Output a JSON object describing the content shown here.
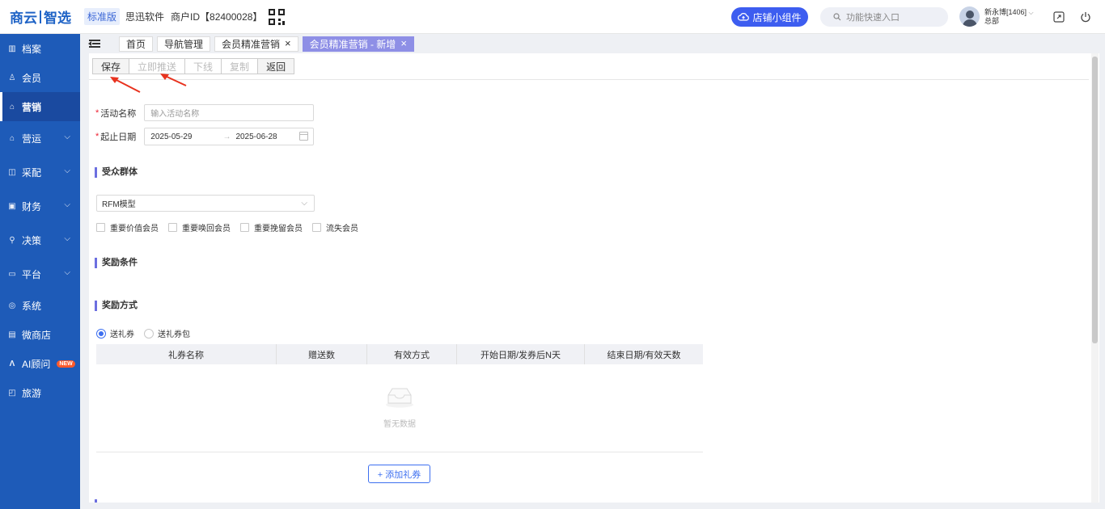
{
  "header": {
    "logo_part1": "商云",
    "logo_part2": "智选",
    "edition": "标准版",
    "company": "思迅软件",
    "merchant_id": "商户ID【82400028】",
    "widget_button": "店铺小组件",
    "search_placeholder": "功能快速入口",
    "user_name": "新永博[1406]",
    "user_org": "总部",
    "qr_icon": "qr-code-icon"
  },
  "sidebar": {
    "items": [
      {
        "label": "档案",
        "icon": "archive-icon"
      },
      {
        "label": "会员",
        "icon": "user-icon"
      },
      {
        "label": "营销",
        "icon": "marketing-icon"
      },
      {
        "label": "营运",
        "icon": "operation-icon"
      },
      {
        "label": "采配",
        "icon": "purchase-icon"
      },
      {
        "label": "财务",
        "icon": "finance-icon"
      },
      {
        "label": "决策",
        "icon": "decision-icon"
      },
      {
        "label": "平台",
        "icon": "platform-icon"
      },
      {
        "label": "系统",
        "icon": "system-icon"
      },
      {
        "label": "微商店",
        "icon": "store-icon"
      },
      {
        "label": "AI顾问",
        "icon": "ai-icon",
        "badge": "NEW"
      },
      {
        "label": "旅游",
        "icon": "travel-icon"
      }
    ]
  },
  "tabs": [
    {
      "label": "首页"
    },
    {
      "label": "导航管理"
    },
    {
      "label": "会员精准营销"
    },
    {
      "label": "会员精准营销 - 新增"
    }
  ],
  "toolbar": {
    "save": "保存",
    "push": "立即推送",
    "offline": "下线",
    "copy": "复制",
    "back": "返回"
  },
  "form": {
    "activity_name_label": "活动名称",
    "activity_name_placeholder": "输入活动名称",
    "date_label": "起止日期",
    "start_date": "2025-05-29",
    "date_sep": "→",
    "end_date": "2025-06-28"
  },
  "audience": {
    "title": "受众群体",
    "select_value": "RFM模型",
    "options": [
      "重要价值会员",
      "重要唤回会员",
      "重要挽留会员",
      "流失会员"
    ]
  },
  "reward_condition": {
    "title": "奖励条件"
  },
  "reward_method": {
    "title": "奖励方式",
    "radio_coupon": "送礼券",
    "radio_package": "送礼券包",
    "selected": "送礼券",
    "columns": [
      "礼券名称",
      "赠送数",
      "有效方式",
      "开始日期/发券后N天",
      "结束日期/有效天数"
    ],
    "empty_text": "暂无数据",
    "add_button": "+ 添加礼券"
  },
  "colors": {
    "sidebar": "#1e5bb8",
    "primary": "#3d5df0",
    "active_tab": "#8e8fe6",
    "annotation_arrow": "#e8321e"
  }
}
